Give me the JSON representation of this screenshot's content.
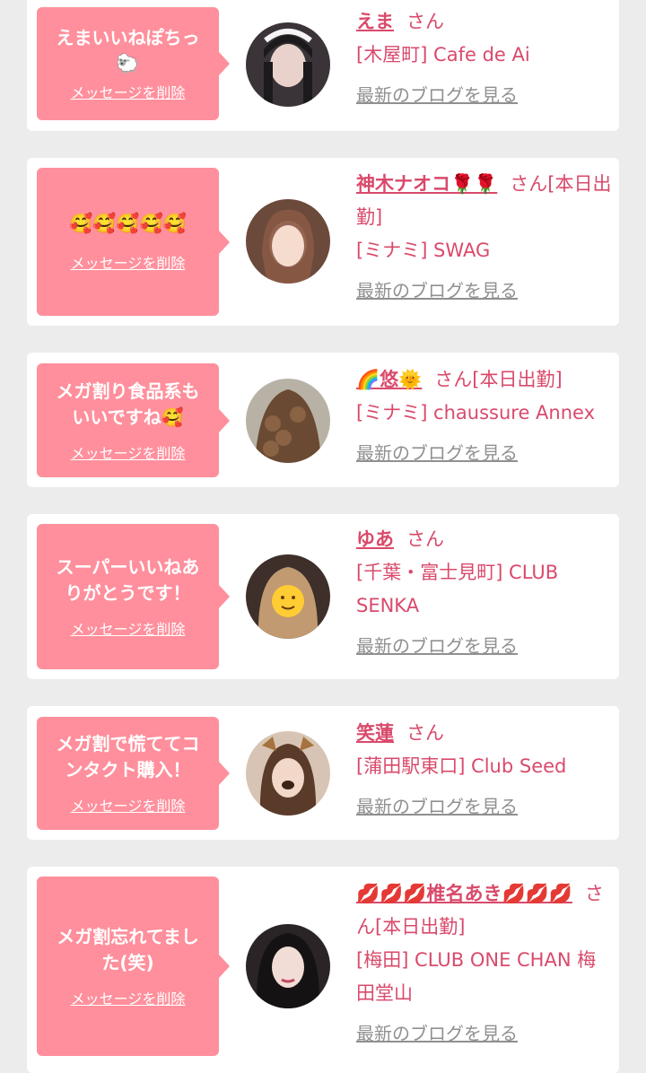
{
  "delete_label": "メッセージを削除",
  "blog_label": "最新のブログを見る",
  "cards": [
    {
      "message": "えまいいねぽちっ",
      "message_extra": "🐑",
      "name": "えま",
      "honorific": "さん",
      "status": "",
      "shop": "[木屋町] Cafe de Ai"
    },
    {
      "message": "",
      "message_extra": "🥰🥰🥰🥰🥰",
      "name": "神木ナオコ🌹🌹",
      "honorific": "さん[本日出勤]",
      "status": "",
      "shop": "[ミナミ] SWAG"
    },
    {
      "message": "メガ割り食品系もいいですね🥰",
      "message_extra": "",
      "name": "🌈悠🌞",
      "honorific": "さん[本日出勤]",
      "status": "",
      "shop": "[ミナミ] chaussure Annex"
    },
    {
      "message": "スーパーいいねありがとうです！",
      "message_extra": "",
      "name": "ゆあ",
      "honorific": "さん",
      "status": "",
      "shop": "[千葉・富士見町] CLUB SENKA"
    },
    {
      "message": "メガ割で慌ててコンタクト購入！",
      "message_extra": "",
      "name": "笑蓮",
      "honorific": "さん",
      "status": "",
      "shop": "[蒲田駅東口] Club Seed"
    },
    {
      "message": "メガ割忘れてました(笑)",
      "message_extra": "",
      "name": "💋💋💋椎名あき💋💋💋",
      "honorific": "さん[本日出勤]",
      "status": "",
      "shop": "[梅田] CLUB ONE CHAN 梅田堂山"
    }
  ]
}
